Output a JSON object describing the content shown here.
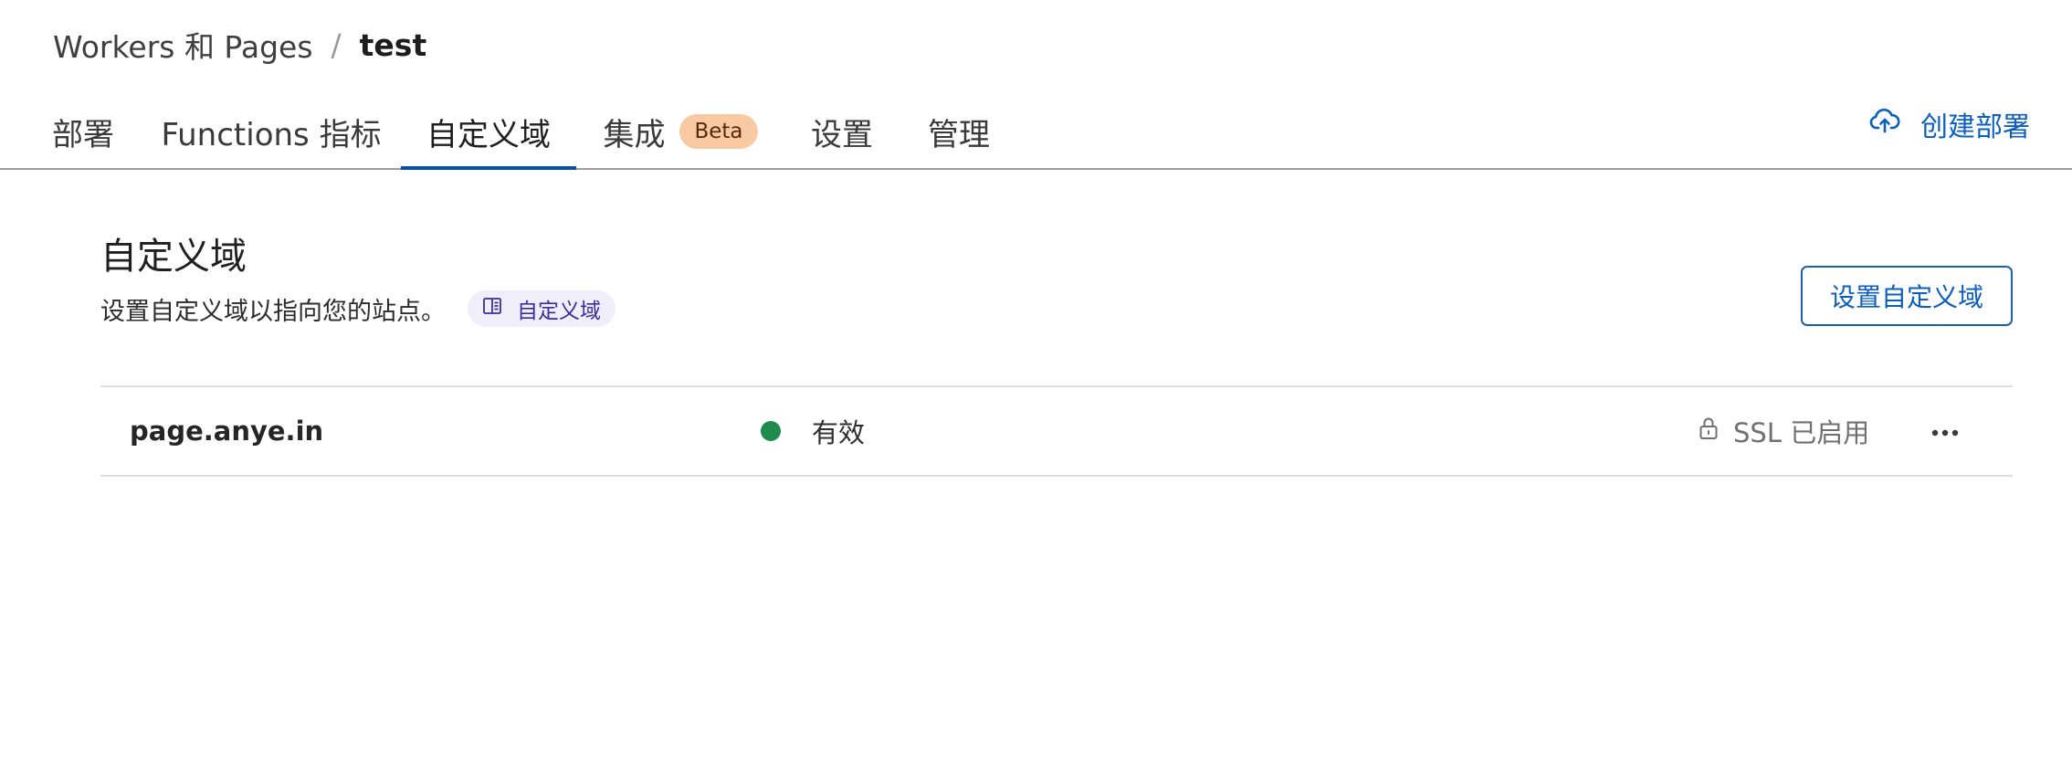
{
  "breadcrumb": {
    "parent": "Workers 和 Pages",
    "separator": "/",
    "current": "test"
  },
  "tabs": [
    {
      "label": "部署"
    },
    {
      "label": "Functions 指标"
    },
    {
      "label": "自定义域",
      "active": true
    },
    {
      "label": "集成",
      "badge": "Beta"
    },
    {
      "label": "设置"
    },
    {
      "label": "管理"
    }
  ],
  "header": {
    "create_deploy_label": "创建部署",
    "create_deploy_icon": "cloud-upload-icon"
  },
  "section": {
    "title": "自定义域",
    "description": "设置自定义域以指向您的站点。",
    "doc_link_label": "自定义域",
    "doc_link_icon": "book-icon",
    "setup_button_label": "设置自定义域"
  },
  "domains": [
    {
      "name": "page.anye.in",
      "status": "有效",
      "status_color": "#1e8a4c",
      "ssl": "SSL 已启用",
      "ssl_icon": "lock-icon",
      "menu_icon": "more-options-icon"
    }
  ],
  "colors": {
    "accent": "#0a5fc1",
    "active_tab_underline": "#0a4fa0",
    "beta_badge_bg": "#f8c9a2",
    "doc_chip_bg": "#efeefa",
    "success": "#1e8a4c"
  }
}
